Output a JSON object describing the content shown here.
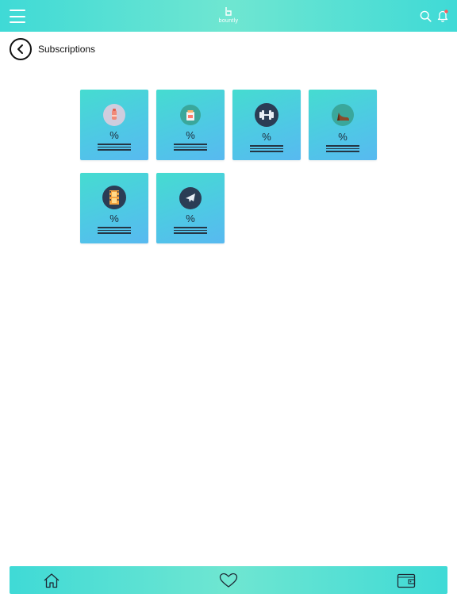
{
  "header": {
    "brand_name": "bountly",
    "icons": {
      "menu": "hamburger-icon",
      "search": "search-icon",
      "notifications": "bell-icon"
    },
    "colors": {
      "bar": "#3fdad6",
      "icon": "#ffffff",
      "badge": "#ff5a5a"
    }
  },
  "page": {
    "title": "Subscriptions",
    "back_icon": "chevron-left-icon"
  },
  "categories": [
    {
      "name": "beauty",
      "icon": "makeup-icon",
      "percent_label": "%",
      "icon_bg": "#c9c7d8"
    },
    {
      "name": "groceries",
      "icon": "shopping-bag-icon",
      "percent_label": "%",
      "icon_bg": "#3aa79b"
    },
    {
      "name": "fitness",
      "icon": "dumbbell-icon",
      "percent_label": "%",
      "icon_bg": "#2b3d55"
    },
    {
      "name": "fashion",
      "icon": "high-heel-icon",
      "percent_label": "%",
      "icon_bg": "#3aa79b"
    },
    {
      "name": "movies",
      "icon": "film-icon",
      "percent_label": "%",
      "icon_bg": "#2b3d55"
    },
    {
      "name": "travel",
      "icon": "airplane-icon",
      "percent_label": "%",
      "icon_bg": "#2b3d55"
    }
  ],
  "tile_colors": {
    "start": "#45dcd0",
    "end": "#58b9f0",
    "text": "#1d2b3a"
  },
  "bottom_nav": {
    "items": [
      {
        "name": "home",
        "icon": "home-icon"
      },
      {
        "name": "favorites",
        "icon": "heart-icon"
      },
      {
        "name": "wallet",
        "icon": "wallet-icon"
      }
    ]
  }
}
